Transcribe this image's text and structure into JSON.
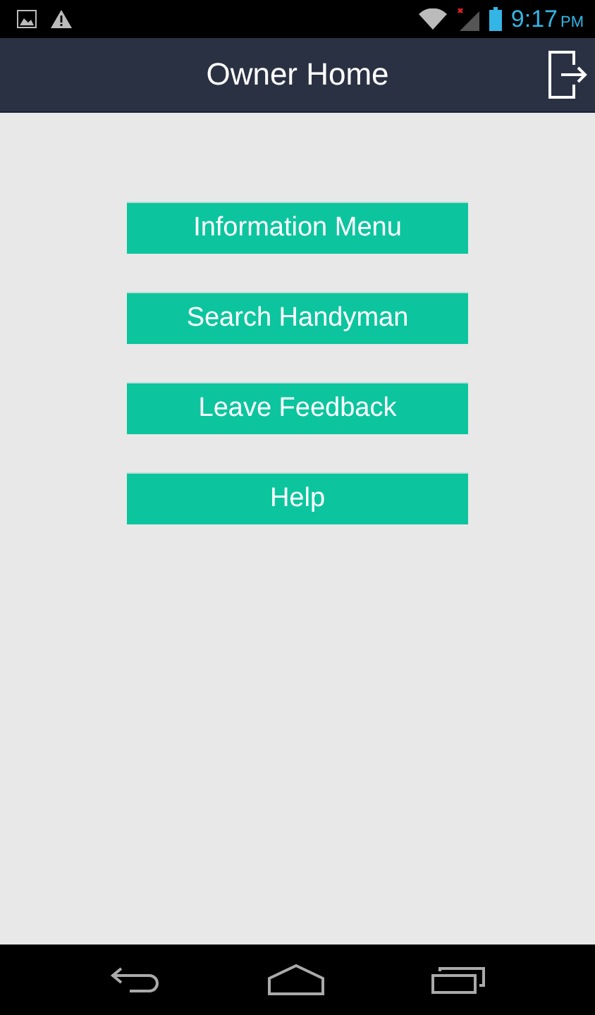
{
  "status_bar": {
    "time": "9:17",
    "period": "PM"
  },
  "app_bar": {
    "title": "Owner Home"
  },
  "buttons": [
    {
      "label": "Information Menu"
    },
    {
      "label": "Search Handyman"
    },
    {
      "label": "Leave Feedback"
    },
    {
      "label": "Help"
    }
  ]
}
